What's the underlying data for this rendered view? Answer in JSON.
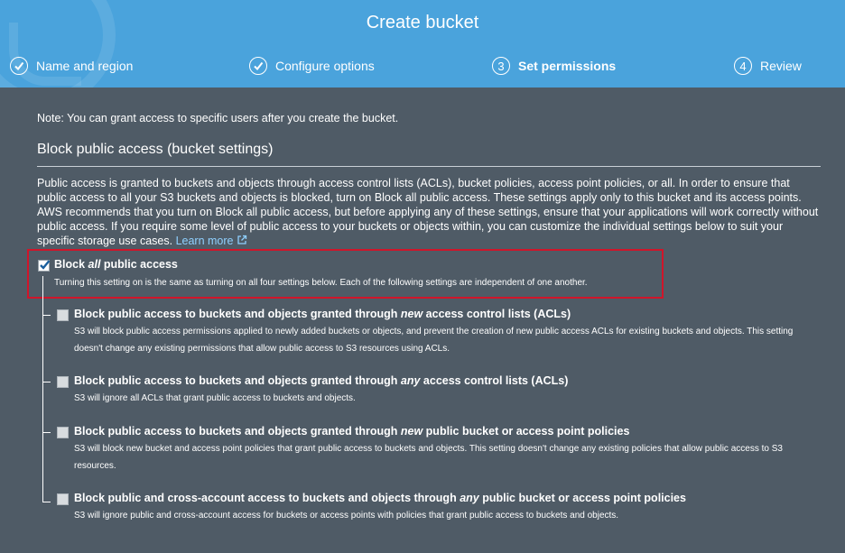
{
  "header": {
    "title": "Create bucket",
    "steps": [
      {
        "label": "Name and region",
        "state": "done",
        "marker": "✓"
      },
      {
        "label": "Configure options",
        "state": "done",
        "marker": "✓"
      },
      {
        "label": "Set permissions",
        "state": "active",
        "marker": "3"
      },
      {
        "label": "Review",
        "state": "pending",
        "marker": "4"
      }
    ]
  },
  "content": {
    "note": "Note: You can grant access to specific users after you create the bucket.",
    "section_title": "Block public access (bucket settings)",
    "description": "Public access is granted to buckets and objects through access control lists (ACLs), bucket policies, access point policies, or all. In order to ensure that public access to all your S3 buckets and objects is blocked, turn on Block all public access. These settings apply only to this bucket and its access points. AWS recommends that you turn on Block all public access, but before applying any of these settings, ensure that your applications will work correctly without public access. If you require some level of public access to your buckets or objects within, you can customize the individual settings below to suit your specific storage use cases.",
    "learn_more": "Learn more"
  },
  "block_all": {
    "label_pre": "Block ",
    "label_em": "all",
    "label_post": " public access",
    "checked": true,
    "subtext": "Turning this setting on is the same as turning on all four settings below. Each of the following settings are independent of one another."
  },
  "options": [
    {
      "label_pre": "Block public access to buckets and objects granted through ",
      "label_em": "new",
      "label_post": " access control lists (ACLs)",
      "checked": false,
      "subtext": "S3 will block public access permissions applied to newly added buckets or objects, and prevent the creation of new public access ACLs for existing buckets and objects. This setting doesn't change any existing permissions that allow public access to S3 resources using ACLs."
    },
    {
      "label_pre": "Block public access to buckets and objects granted through ",
      "label_em": "any",
      "label_post": " access control lists (ACLs)",
      "checked": false,
      "subtext": "S3 will ignore all ACLs that grant public access to buckets and objects."
    },
    {
      "label_pre": "Block public access to buckets and objects granted through ",
      "label_em": "new",
      "label_post": " public bucket or access point policies",
      "checked": false,
      "subtext": "S3 will block new bucket and access point policies that grant public access to buckets and objects. This setting doesn't change any existing policies that allow public access to S3 resources."
    },
    {
      "label_pre": "Block public and cross-account access to buckets and objects through ",
      "label_em": "any",
      "label_post": " public bucket or access point policies",
      "checked": false,
      "subtext": "S3 will ignore public and cross-account access for buckets or access points with policies that grant public access to buckets and objects."
    }
  ],
  "colors": {
    "header_bg": "#4aa3dc",
    "page_bg": "#4f5b66",
    "highlight_border": "#d0152a",
    "link": "#8fd0ff"
  }
}
